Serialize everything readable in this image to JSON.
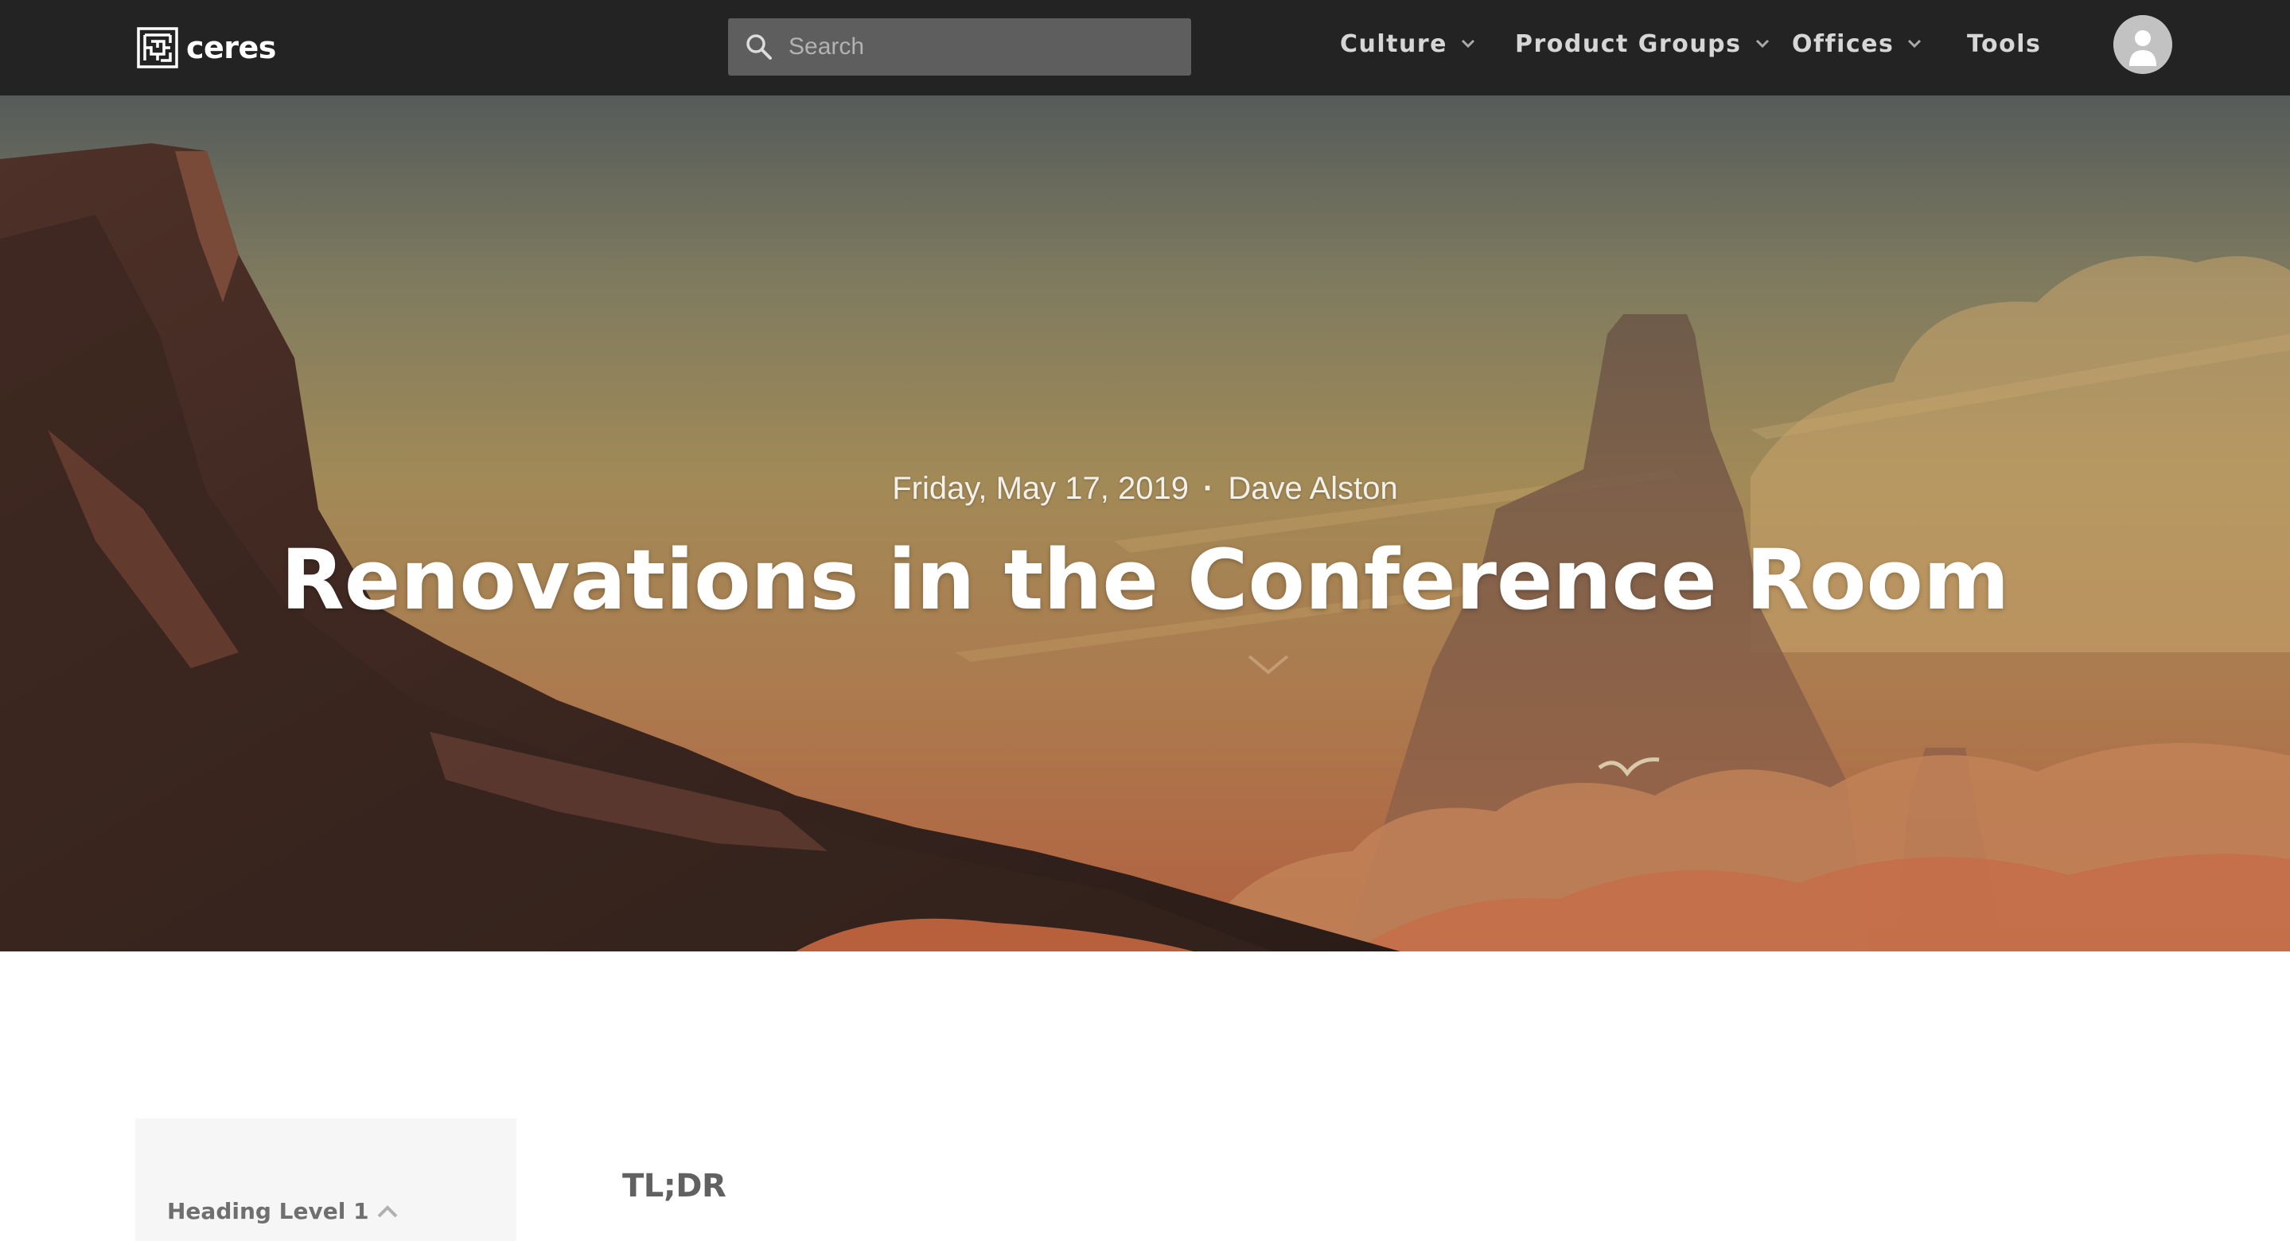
{
  "brand": {
    "name": "ceres"
  },
  "search": {
    "placeholder": "Search"
  },
  "nav": {
    "items": [
      {
        "label": "Culture",
        "has_dropdown": true
      },
      {
        "label": "Product Groups",
        "has_dropdown": true
      },
      {
        "label": "Offices",
        "has_dropdown": true
      },
      {
        "label": "Tools",
        "has_dropdown": false
      }
    ]
  },
  "article": {
    "date": "Friday, May 17, 2019",
    "separator": "·",
    "author": "Dave Alston",
    "title": "Renovations in the Conference Room"
  },
  "toc": {
    "items": [
      {
        "label": "Heading Level 1"
      }
    ]
  },
  "content": {
    "first_heading": "TL;DR"
  },
  "colors": {
    "navbar_bg": "#232323",
    "search_bg": "#5e5e5e",
    "nav_text": "#d6d6d6",
    "hero_sky_top": "#555b5a",
    "hero_sky_bottom": "#b26a45",
    "toc_bg": "#f6f6f6",
    "heading_text": "#616161"
  },
  "icons": {
    "logo": "maze-logo-icon",
    "search": "search-icon",
    "dropdown": "chevron-down-icon",
    "avatar": "user-avatar-icon",
    "toc_toggle": "chevron-up-icon"
  }
}
